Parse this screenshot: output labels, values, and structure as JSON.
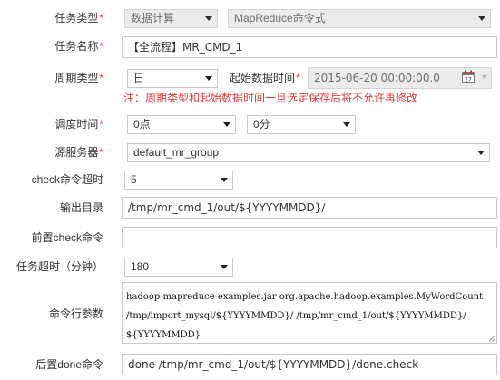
{
  "form": {
    "task_type": {
      "label": "任务类型",
      "required": "*",
      "value": "数据计算",
      "sub_value": "MapReduce命令式"
    },
    "task_name": {
      "label": "任务名称",
      "required": "*",
      "value": "【全流程】MR_CMD_1"
    },
    "cycle_type": {
      "label": "周期类型",
      "required": "*",
      "value": "日"
    },
    "start_time": {
      "label": "起始数据时间",
      "required": "*",
      "value": "2015-06-20 00:00:00.0"
    },
    "warning": "注：周期类型和起始数据时间一旦选定保存后将不允许再修改",
    "schedule_time": {
      "label": "调度时间",
      "required": "*",
      "hour": "0点",
      "minute": "0分"
    },
    "source_server": {
      "label": "源服务器",
      "required": "*",
      "value": "default_mr_group"
    },
    "check_timeout": {
      "label": "check命令超时",
      "value": "5"
    },
    "output_dir": {
      "label": "输出目录",
      "value": "/tmp/mr_cmd_1/out/${YYYYMMDD}/"
    },
    "pre_check_cmd": {
      "label": "前置check命令",
      "value": ""
    },
    "task_timeout": {
      "label": "任务超时（分钟）",
      "value": "180"
    },
    "cmd_params": {
      "label": "命令行参数",
      "lines": [
        "hadoop-mapreduce-examples.jar org.apache.hadoop.examples.MyWordCount",
        "/tmp/import_mysql/${YYYYMMDD}/ /tmp/mr_cmd_1/out/${YYYYMMDD}/",
        "${YYYYMMDD}"
      ]
    },
    "post_done_cmd": {
      "label": "后置done命令",
      "value": "done /tmp/mr_cmd_1/out/${YYYYMMDD}/done.check"
    }
  },
  "icons": {
    "calendar": "calendar-icon",
    "dropdown": "chevron-down-icon",
    "resize": "resize-grip-icon"
  },
  "colors": {
    "required": "#e4393c",
    "disabled_bg": "#ebebeb",
    "border": "#c9c9c9"
  }
}
